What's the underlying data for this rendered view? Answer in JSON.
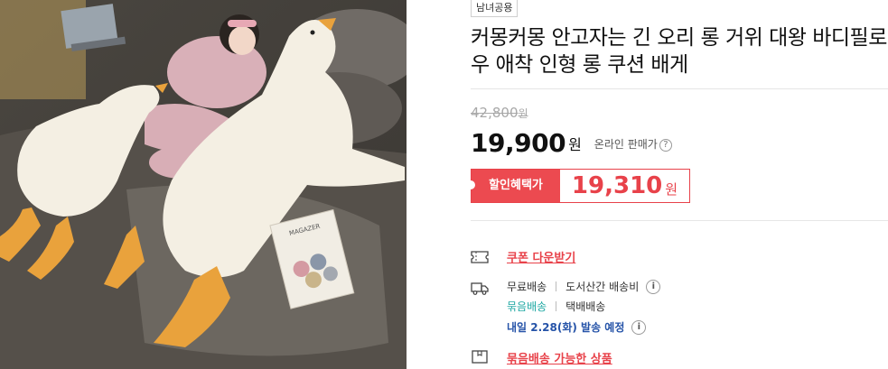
{
  "product": {
    "badge": "남녀공용",
    "title": "커몽커몽 안고자는 긴 오리 롱 거위 대왕 바디필로우 애착 인형 롱 쿠션 배게",
    "image_alt": "거위 인형 바디필로우 상품 이미지",
    "magazine_text": "MAGAZER"
  },
  "price": {
    "original": "42,800",
    "original_unit": "원",
    "sale": "19,900",
    "sale_unit": "원",
    "online_label": "온라인 판매가",
    "help_icon": "question-icon"
  },
  "benefit": {
    "label": "할인혜택가",
    "value": "19,310",
    "unit": "원"
  },
  "coupon": {
    "icon": "coupon-icon",
    "link_text": "쿠폰 다운받기"
  },
  "shipping": {
    "icon": "truck-icon",
    "free_label": "무료배송",
    "island_label": "도서산간 배송비",
    "bundle_label": "묶음배송",
    "parcel_label": "택배배송",
    "delivery_text": "내일 2.28(화) 발송 예정",
    "info_icon": "info-icon"
  },
  "bundle": {
    "icon": "box-icon",
    "link_text": "묶음배송 가능한 상품"
  },
  "colors": {
    "accent_red": "#e8424a",
    "teal": "#1fa8a3",
    "delivery_blue": "#2553a8"
  }
}
